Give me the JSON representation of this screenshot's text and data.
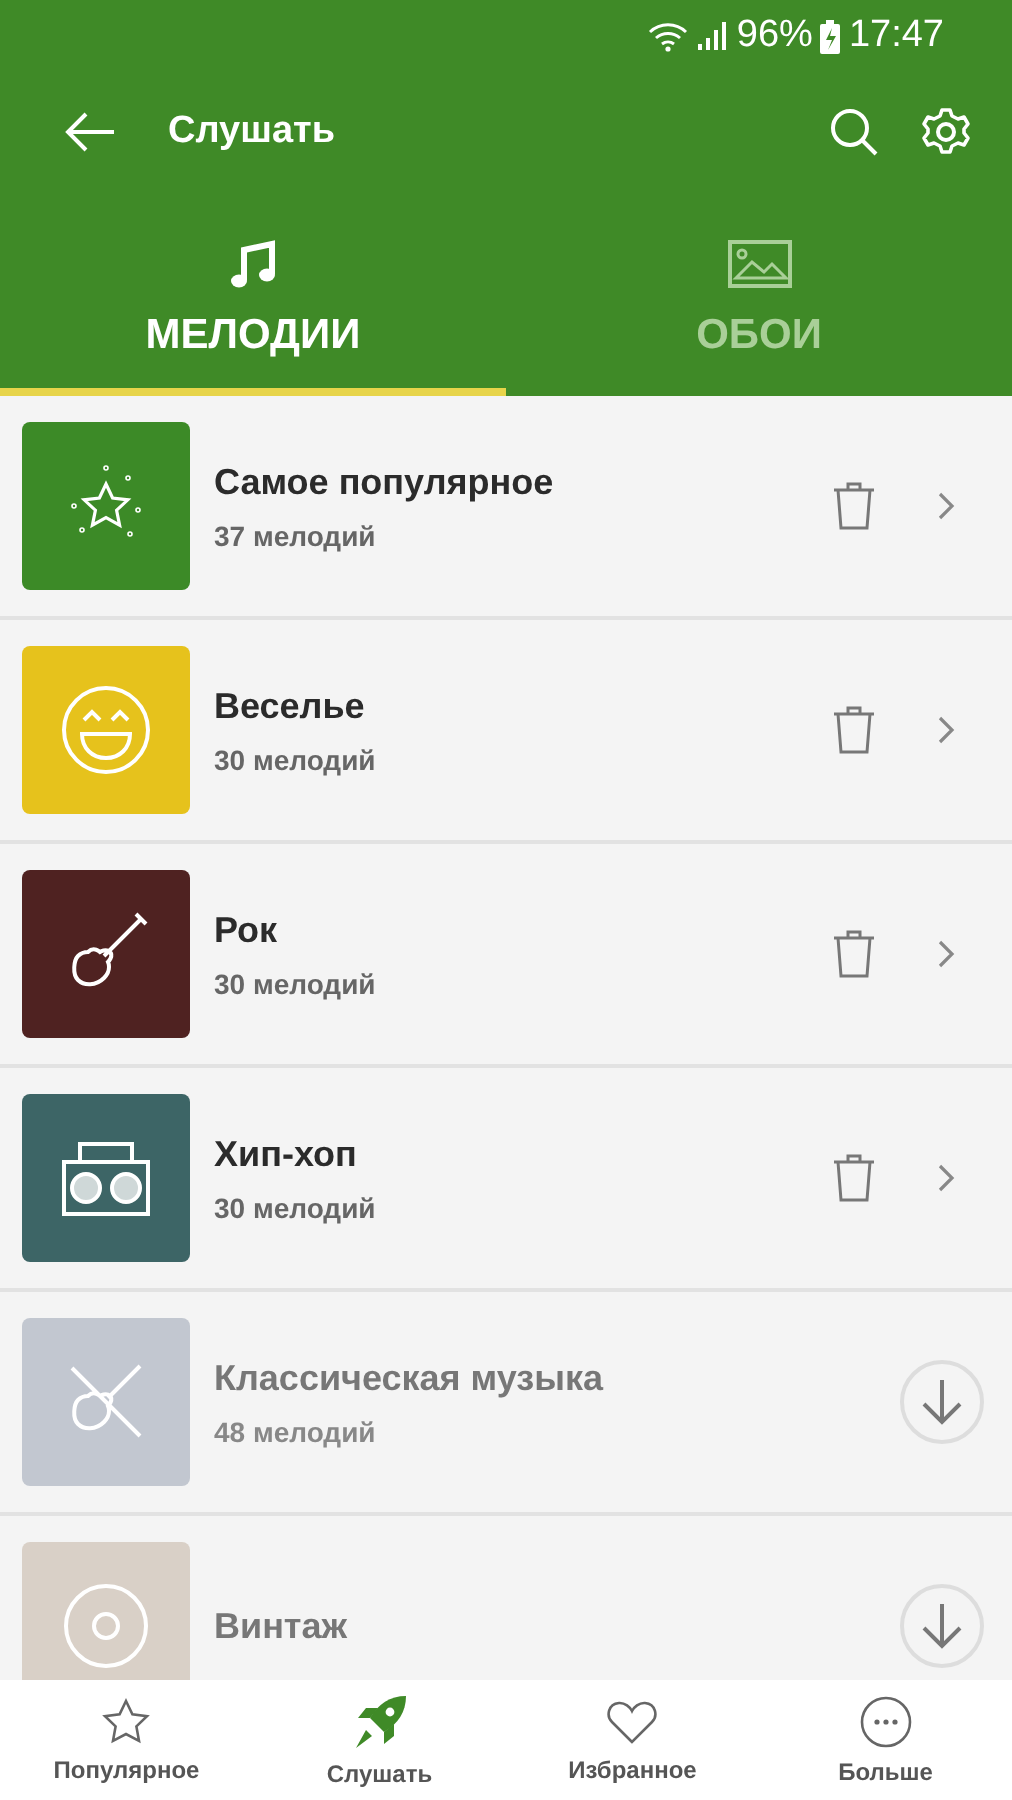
{
  "status_bar": {
    "battery": "96%",
    "time": "17:47"
  },
  "app_bar": {
    "title": "Слушать"
  },
  "tabs": [
    {
      "label": "МЕЛОДИИ",
      "selected": true
    },
    {
      "label": "ОБОИ",
      "selected": false
    }
  ],
  "categories": [
    {
      "title": "Самое популярное",
      "count": "37 мелодий",
      "color": "#3c8a27",
      "kind": "installed"
    },
    {
      "title": "Веселье",
      "count": "30 мелодий",
      "color": "#e6c21c",
      "kind": "installed"
    },
    {
      "title": "Рок",
      "count": "30 мелодий",
      "color": "#4f2221",
      "kind": "installed"
    },
    {
      "title": "Хип-хоп",
      "count": "30 мелодий",
      "color": "#3d6566",
      "kind": "installed"
    },
    {
      "title": "Классическая музыка",
      "count": "48 мелодий",
      "color": "#c2c7d0",
      "kind": "download"
    },
    {
      "title": "Винтаж",
      "color": "#d9d0c7",
      "kind": "download"
    }
  ],
  "bottom_nav": [
    {
      "label": "Популярное",
      "selected": false
    },
    {
      "label": "Слушать",
      "selected": true
    },
    {
      "label": "Избранное",
      "selected": false
    },
    {
      "label": "Больше",
      "selected": false
    }
  ]
}
